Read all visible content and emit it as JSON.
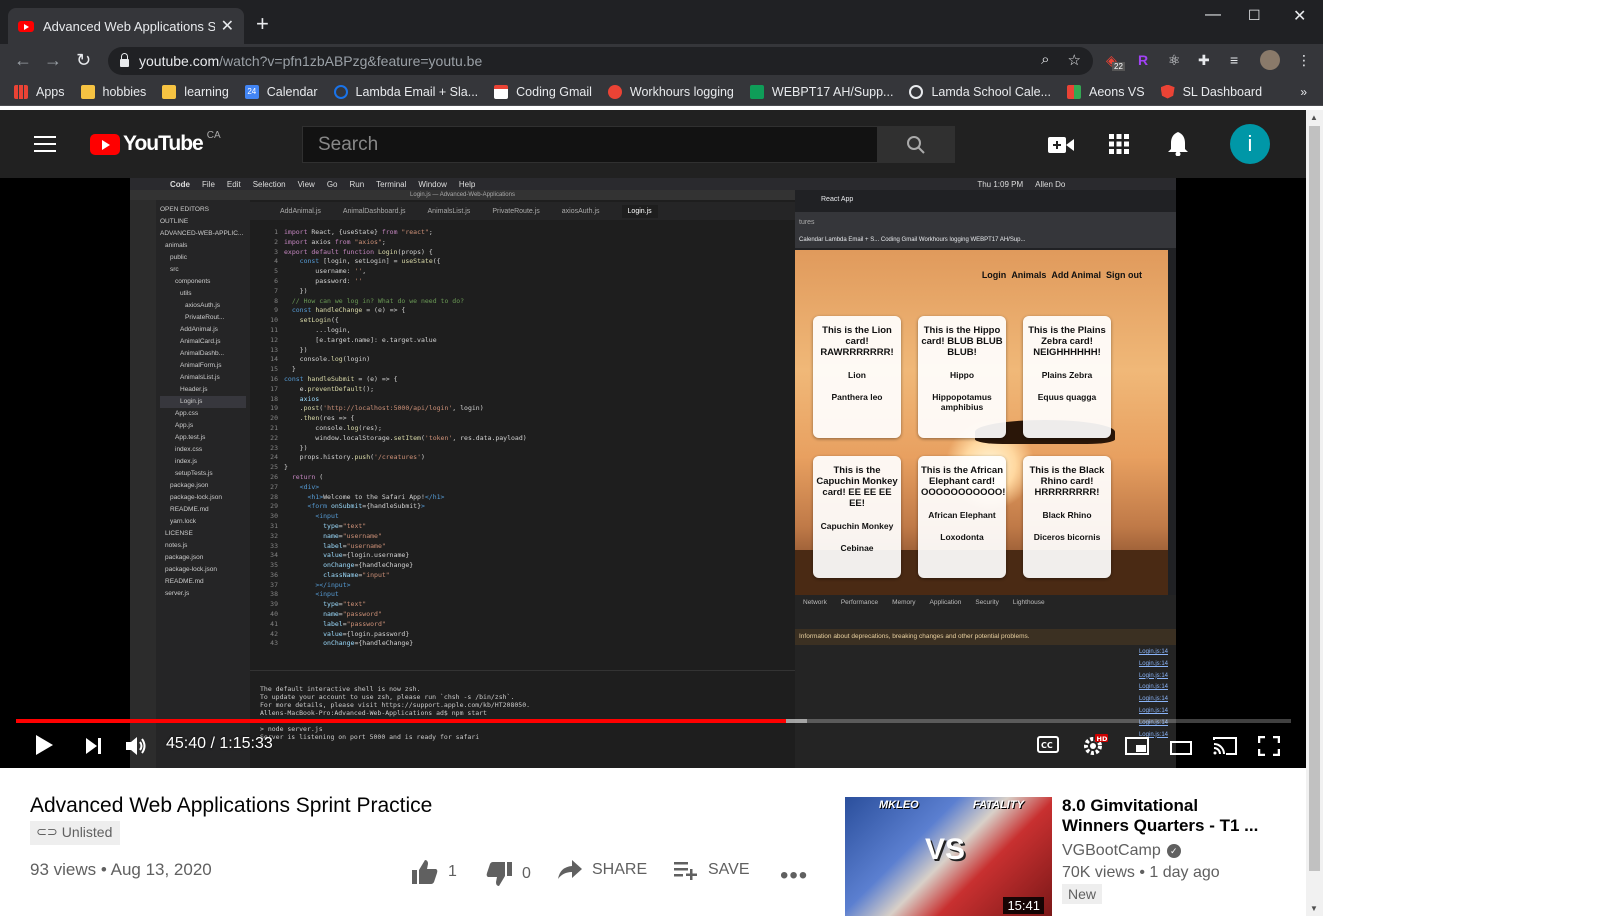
{
  "browser": {
    "tab_title": "Advanced Web Applications Sprint",
    "url_host": "youtube.com",
    "url_path": "/watch?v=pfn1zbABPzg&feature=youtu.be",
    "extension_badge": "22"
  },
  "bookmarks": [
    {
      "label": "Apps",
      "color": "#f4b400"
    },
    {
      "label": "hobbies",
      "color": "#f6c342"
    },
    {
      "label": "learning",
      "color": "#f6c342"
    },
    {
      "label": "Calendar",
      "color": "#4285f4",
      "badge": "24"
    },
    {
      "label": "Lambda Email + Sla...",
      "color": "#1a73e8"
    },
    {
      "label": "Coding Gmail",
      "color": "#ea4335"
    },
    {
      "label": "Workhours logging",
      "color": "#ea4335"
    },
    {
      "label": "WEBPT17 AH/Supp...",
      "color": "#0f9d58"
    },
    {
      "label": "Lamda School Cale...",
      "color": "#e8eaed"
    },
    {
      "label": "Aeons VS",
      "color": "#fbbc05"
    },
    {
      "label": "SL Dashboard",
      "color": "#ea4335"
    }
  ],
  "youtube": {
    "logo_text": "YouTube",
    "region": "CA",
    "search_placeholder": "Search",
    "avatar_letter": "i"
  },
  "video_screen": {
    "mac_menu": [
      "Code",
      "File",
      "Edit",
      "Selection",
      "View",
      "Go",
      "Run",
      "Terminal",
      "Window",
      "Help"
    ],
    "mac_clock": "Thu 1:09 PM",
    "mac_user": "Allen Do",
    "window_title": "Login.js — Advanced-Web-Applications",
    "editor_tabs": [
      "AddAnimal.js",
      "AnimalDashboard.js",
      "AnimalsList.js",
      "PrivateRoute.js",
      "axiosAuth.js",
      "Login.js"
    ],
    "explorer_items": [
      "OPEN EDITORS",
      "OUTLINE",
      "ADVANCED-WEB-APPLIC...",
      "animals",
      "public",
      "src",
      "components",
      "utils",
      "axiosAuth.js",
      "PrivateRout...",
      "AddAnimal.js",
      "AnimalCard.js",
      "AnimalDashb...",
      "AnimalForm.js",
      "AnimalsList.js",
      "Header.js",
      "Login.js",
      "App.css",
      "App.js",
      "App.test.js",
      "index.css",
      "index.js",
      "setupTests.js",
      "package.json",
      "package-lock.json",
      "README.md",
      "yarn.lock",
      "LICENSE",
      "notes.js",
      "package.json",
      "package-lock.json",
      "README.md",
      "server.js"
    ],
    "terminal_lines": [
      "The default interactive shell is now zsh.",
      "To update your account to use zsh, please run `chsh -s /bin/zsh`.",
      "For more details, please visit https://support.apple.com/kb/HT208050.",
      "Allens-MacBook-Pro:Advanced-Web-Applications ad$ npm start",
      "",
      "> node server.js",
      "Server is listening on port 5000 and is ready for safari"
    ],
    "react_tab": "React App",
    "react_url": "tures",
    "react_bookmarks": "Calendar   Lambda Email + S...   Coding Gmail   Workhours logging   WEBPT17 AH/Sup...",
    "nav_links": [
      "Login",
      "Animals",
      "Add Animal",
      "Sign out"
    ],
    "cards": [
      {
        "title": "This is the Lion card! RAWRRRRRRR!",
        "name": "Lion",
        "sci": "Panthera leo"
      },
      {
        "title": "This is the Hippo card! BLUB BLUB BLUB!",
        "name": "Hippo",
        "sci": "Hippopotamus amphibius"
      },
      {
        "title": "This is the Plains Zebra card! NEIGHHHHHH!",
        "name": "Plains Zebra",
        "sci": "Equus quagga"
      },
      {
        "title": "This is the Capuchin Monkey card! EE EE EE EE!",
        "name": "Capuchin Monkey",
        "sci": "Cebinae"
      },
      {
        "title": "This is the African Elephant card! OOOOOOOOOOO!",
        "name": "African Elephant",
        "sci": "Loxodonta"
      },
      {
        "title": "This is the Black Rhino card! HRRRRRRRR!",
        "name": "Black Rhino",
        "sci": "Diceros bicornis"
      }
    ],
    "devtools_tabs": [
      "Network",
      "Performance",
      "Memory",
      "Application",
      "Security",
      "Lighthouse"
    ],
    "devtools_warning": "Information about deprecations, breaking changes and other potential problems.",
    "devtools_link": "Login.js:14"
  },
  "player": {
    "current_time": "45:40",
    "duration": "1:15:33",
    "time_display": "45:40 / 1:15:33",
    "progress_fraction": 0.604,
    "buffered_fraction": 0.62
  },
  "video_info": {
    "title": "Advanced Web Applications Sprint Practice",
    "visibility": "Unlisted",
    "views": "93 views",
    "date": "Aug 13, 2020",
    "meta_line": "93 views • Aug 13, 2020",
    "likes": "1",
    "dislikes": "0",
    "share_label": "SHARE",
    "save_label": "SAVE"
  },
  "recommendation": {
    "title": "8.0 Gimvitational Winners Quarters - T1 ...",
    "channel": "VGBootCamp",
    "meta": "70K views • 1 day ago",
    "badge": "New",
    "duration": "15:41",
    "thumb_left": "MKLEO",
    "thumb_right": "FATALITY",
    "thumb_vs": "VS"
  }
}
